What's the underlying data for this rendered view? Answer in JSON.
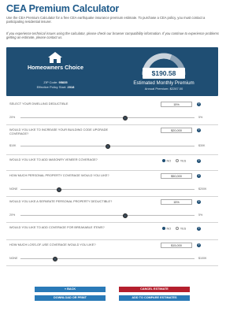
{
  "page": {
    "title": "CEA Premium Calculator",
    "intro": "Use the CEA Premium Calculator for a free CEA earthquake insurance premium estimate. To purchase a CEA policy, you must contact a participating residential insurer.",
    "note": "If you experience technical issues using the calculator, please check our browser compatibility information. If you continue to experience problems getting an estimate, please contact us."
  },
  "hero": {
    "title": "Homeowners Choice",
    "zip_label": "ZIP Code:",
    "zip_value": "95835",
    "effective_label": "Effective Policy Start:",
    "effective_value": "2018",
    "monthly_value": "$190.58",
    "monthly_label": "Estimated Monthly Premium",
    "annual_label": "Annual Premium:",
    "annual_value": "$2287.00",
    "gauge_fraction": 0.62
  },
  "questions": [
    {
      "label": "Select your dwelling deductible",
      "value": "15%",
      "min": "20%",
      "max": "5%",
      "slider": 0.6
    },
    {
      "label": "Would you like to increase your building code upgrade coverage?",
      "value": "$20,000",
      "min": "$10K",
      "max": "$30K",
      "slider": 0.5
    },
    {
      "label": "Would you like to add masonry veneer coverage?",
      "no": "NO",
      "yes": "YES",
      "selected": "NO"
    },
    {
      "label": "How much personal property coverage would you like?",
      "value": "$50,000",
      "min": "NONE",
      "max": "$200K",
      "slider": 0.22
    },
    {
      "label": "Would you like a separate personal property deductible?",
      "value": "15%",
      "min": "20%",
      "max": "5%",
      "slider": 0.6
    },
    {
      "label": "Would you like to add coverage for breakable items?",
      "no": "NO",
      "yes": "YES",
      "selected": "NO"
    },
    {
      "label": "How much loss-of-use coverage would you like?",
      "value": "$15,000",
      "min": "NONE",
      "max": "$100K",
      "slider": 0.2
    }
  ],
  "buttons": {
    "back": "« Back",
    "cancel": "Cancel Estimate",
    "download": "Download or Print",
    "compare": "Add to Compare Estimates"
  },
  "colors": {
    "navy": "#1f4e73",
    "blue": "#2a7ab8",
    "red": "#b41f2d"
  }
}
